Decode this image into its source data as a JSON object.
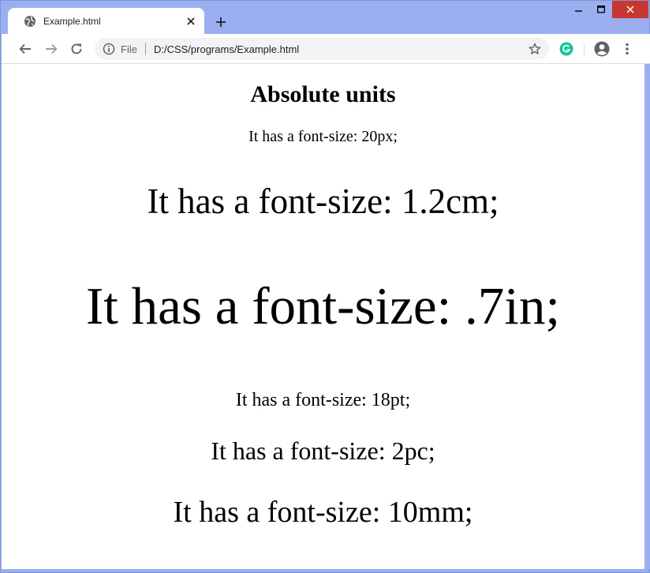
{
  "browser": {
    "tab_title": "Example.html",
    "address": {
      "scheme_label": "File",
      "url": "D:/CSS/programs/Example.html"
    }
  },
  "page": {
    "heading": "Absolute units",
    "lines": [
      "It has a font-size: 20px;",
      "It has a font-size: 1.2cm;",
      "It has a font-size: .7in;",
      "It has a font-size: 18pt;",
      "It has a font-size: 2pc;",
      "It has a font-size: 10mm;"
    ]
  },
  "colors": {
    "frame": "#9aaef0",
    "close_button": "#c7372f",
    "omnibox": "#f1f3f4",
    "grammarly": "#15c39a"
  },
  "icons": {
    "tab": "globe-icon",
    "nav": [
      "back-arrow-icon",
      "forward-arrow-icon",
      "reload-icon"
    ],
    "omnibox": [
      "info-icon",
      "star-icon"
    ],
    "toolbar_right": [
      "grammarly-icon",
      "profile-icon",
      "menu-dots-icon"
    ]
  }
}
